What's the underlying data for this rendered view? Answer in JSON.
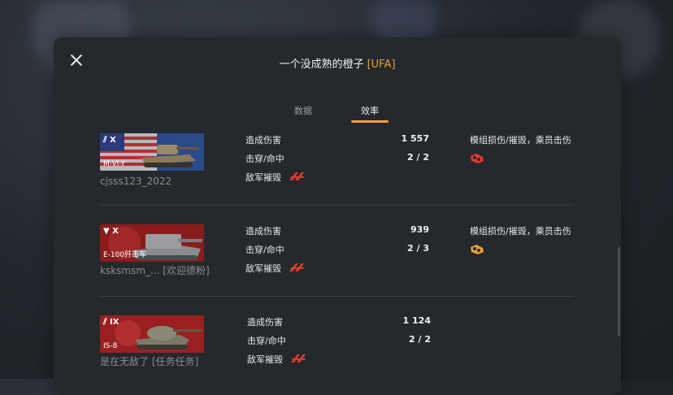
{
  "header": {
    "player_name": "一个没成熟的橙子",
    "clan_tag": "[UFA]"
  },
  "tabs": [
    {
      "label": "数据"
    },
    {
      "label": "效率"
    }
  ],
  "active_tab": "效率",
  "rows": [
    {
      "tier": "X",
      "tank": "M-VI-Y",
      "player": "cjsss123_2022",
      "damage_label": "造成伤害",
      "damage": "1 557",
      "pen_label": "击穿/命中",
      "pen": "2 / 2",
      "kill_label": "敌军摧毁",
      "crit_label": "模组损伤/摧毁，乘员击伤",
      "crit_color": "#e03a30",
      "flag": "usa"
    },
    {
      "tier": "X",
      "tank": "E-100歼击车",
      "player": "ksksmsm_... [欢迎德粉]",
      "damage_label": "造成伤害",
      "damage": "939",
      "pen_label": "击穿/命中",
      "pen": "2 / 3",
      "kill_label": "敌军摧毁",
      "crit_label": "模组损伤/摧毁，乘员击伤",
      "crit_color": "#e6a23c",
      "flag": "germany"
    },
    {
      "tier": "IX",
      "tank": "IS-8",
      "player": "是在无敌了 [任务任务]",
      "damage_label": "造成伤害",
      "damage": "1 124",
      "pen_label": "击穿/命中",
      "pen": "2 / 2",
      "kill_label": "敌军摧毁",
      "flag": "ussr"
    }
  ],
  "colors": {
    "accent": "#f0a030",
    "kill": "#e03a30",
    "panel": "#25282c"
  }
}
